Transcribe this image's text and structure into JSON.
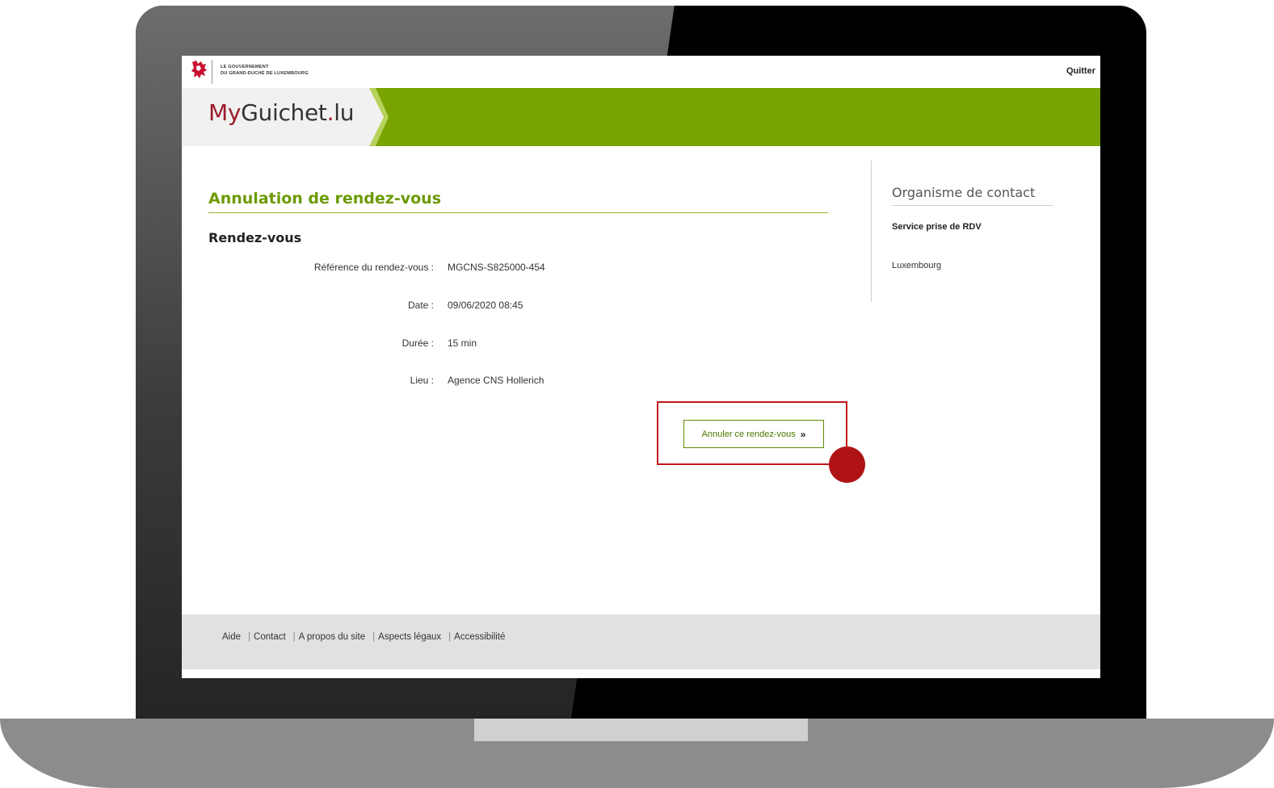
{
  "gov": {
    "line1": "LE GOUVERNEMENT",
    "line2": "DU GRAND-DUCHÉ DE LUXEMBOURG"
  },
  "topbar": {
    "quit_label": "Quitter"
  },
  "brand": {
    "my": "My",
    "guichet": "Guichet",
    "dot": ".",
    "lu": "lu"
  },
  "page": {
    "title": "Annulation de rendez-vous",
    "section_title": "Rendez-vous",
    "fields": [
      {
        "label": "Référence du rendez-vous :",
        "value": "MGCNS-S825000-454"
      },
      {
        "label": "Date :",
        "value": "09/06/2020 08:45"
      },
      {
        "label": "Durée :",
        "value": "15 min"
      },
      {
        "label": "Lieu :",
        "value": "Agence CNS Hollerich"
      }
    ],
    "cancel_button_label": "Annuler ce rendez-vous",
    "cancel_button_chevron": "»"
  },
  "sidebar": {
    "title": "Organisme de contact",
    "org": "Service prise de RDV",
    "city": "Luxembourg"
  },
  "footer": {
    "links": [
      "Aide",
      "Contact",
      "A propos du site",
      "Aspects légaux",
      "Accessibilité"
    ],
    "separator": "|"
  },
  "colors": {
    "brand_green": "#78a300",
    "title_green": "#6b9a00",
    "brand_red": "#9b1c2a",
    "highlight_red": "#c0171b"
  },
  "icons": {
    "gov_logo": "lion-crest-icon"
  }
}
